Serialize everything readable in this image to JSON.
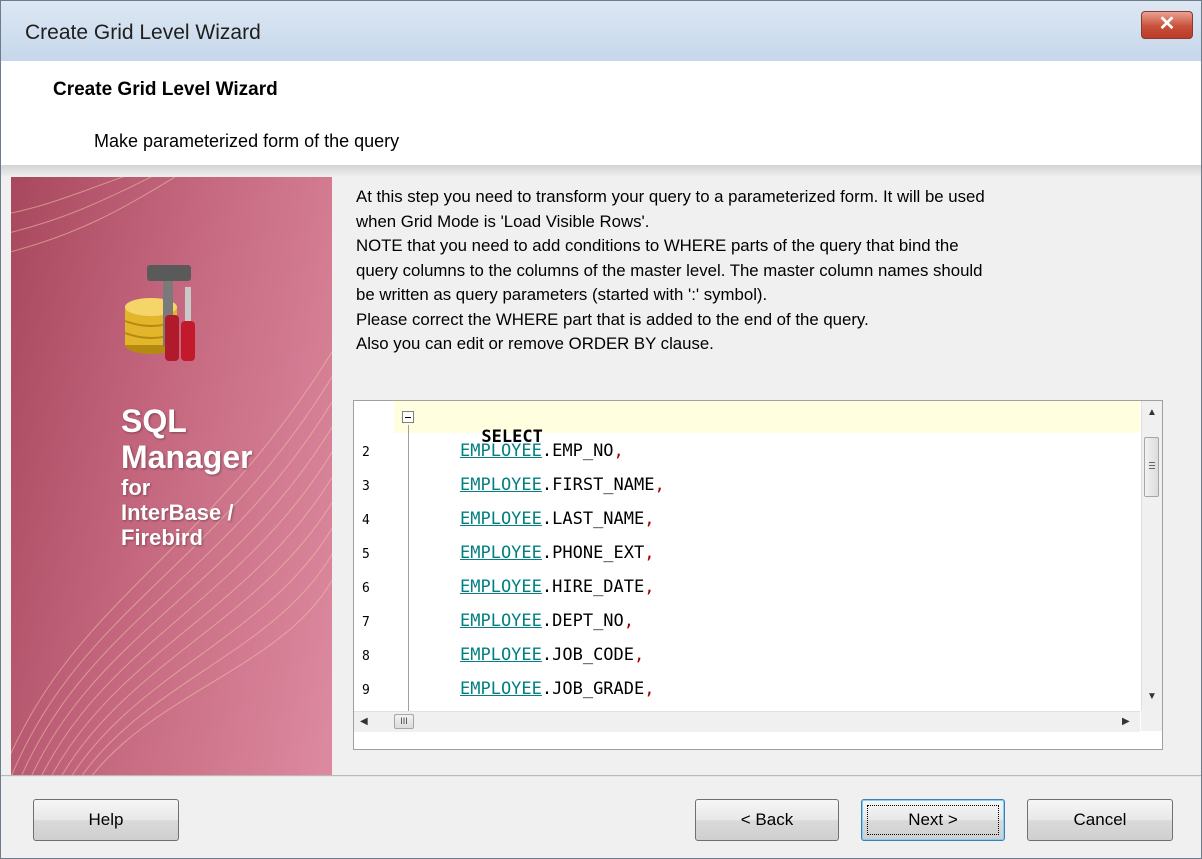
{
  "window": {
    "title": "Create Grid Level Wizard",
    "close_label": "✕"
  },
  "header": {
    "title": "Create Grid Level Wizard",
    "subtitle": "Make parameterized form of the query"
  },
  "sidebar": {
    "brand_lines": [
      "SQL",
      "Manager",
      "for",
      "InterBase /",
      "Firebird"
    ]
  },
  "description": [
    "At this step you need to transform your query to a parameterized form. It will be used",
    "when Grid Mode is 'Load Visible Rows'.",
    "NOTE that you need to add conditions to WHERE parts of the query that bind the",
    "query columns to the columns of the master level. The master column names should",
    "be written as query parameters (started with ':' symbol).",
    "Please correct the WHERE part that is added to the end of the query.",
    "Also you can edit or remove ORDER BY clause."
  ],
  "editor": {
    "keyword": "SELECT",
    "lines": [
      {
        "num": "2",
        "table": "EMPLOYEE",
        "column": ".EMP_NO",
        "comma": ","
      },
      {
        "num": "3",
        "table": "EMPLOYEE",
        "column": ".FIRST_NAME",
        "comma": ","
      },
      {
        "num": "4",
        "table": "EMPLOYEE",
        "column": ".LAST_NAME",
        "comma": ","
      },
      {
        "num": "5",
        "table": "EMPLOYEE",
        "column": ".PHONE_EXT",
        "comma": ","
      },
      {
        "num": "6",
        "table": "EMPLOYEE",
        "column": ".HIRE_DATE",
        "comma": ","
      },
      {
        "num": "7",
        "table": "EMPLOYEE",
        "column": ".DEPT_NO",
        "comma": ","
      },
      {
        "num": "8",
        "table": "EMPLOYEE",
        "column": ".JOB_CODE",
        "comma": ","
      },
      {
        "num": "9",
        "table": "EMPLOYEE",
        "column": ".JOB_GRADE",
        "comma": ","
      }
    ],
    "h_thumb_label": "III"
  },
  "buttons": {
    "help": "Help",
    "back": "< Back",
    "next": "Next >",
    "cancel": "Cancel"
  },
  "colors": {
    "sidebar_accent": "#c5687f",
    "table_name": "#008080",
    "comma": "#a00000"
  }
}
